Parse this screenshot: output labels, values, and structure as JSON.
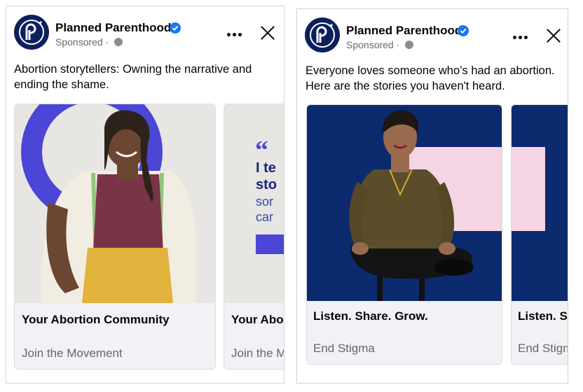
{
  "colors": {
    "brand_navy": "#0d1f5c",
    "verified_blue": "#1877f2",
    "ring_purple": "#4b46d6",
    "deep_blue": "#0c2a6e",
    "pink_panel": "#f5d5e3",
    "card_footer": "#f0f2f5"
  },
  "posts": [
    {
      "page_name": "Planned Parenthood",
      "sponsored": "Sponsored ·",
      "caption": "Abortion storytellers: Owning the narrative and ending the shame.",
      "cards": [
        {
          "headline": "Your Abortion Community",
          "cta": "Join the Movement"
        },
        {
          "headline": "Your Abortion Community",
          "cta": "Join the Movement",
          "quote_mark": "“",
          "quote_bold_1": "I te",
          "quote_bold_2": "sto",
          "quote_text_1": "sor",
          "quote_text_2": "car"
        }
      ]
    },
    {
      "page_name": "Planned Parenthood",
      "sponsored": "Sponsored ·",
      "caption": "Everyone loves someone who’s had an abortion. Here are the stories you haven't heard.",
      "cards": [
        {
          "headline": "Listen. Share. Grow.",
          "cta": "End Stigma"
        },
        {
          "headline": "Listen. Share. Grow.",
          "cta": "End Stigma"
        }
      ]
    }
  ]
}
